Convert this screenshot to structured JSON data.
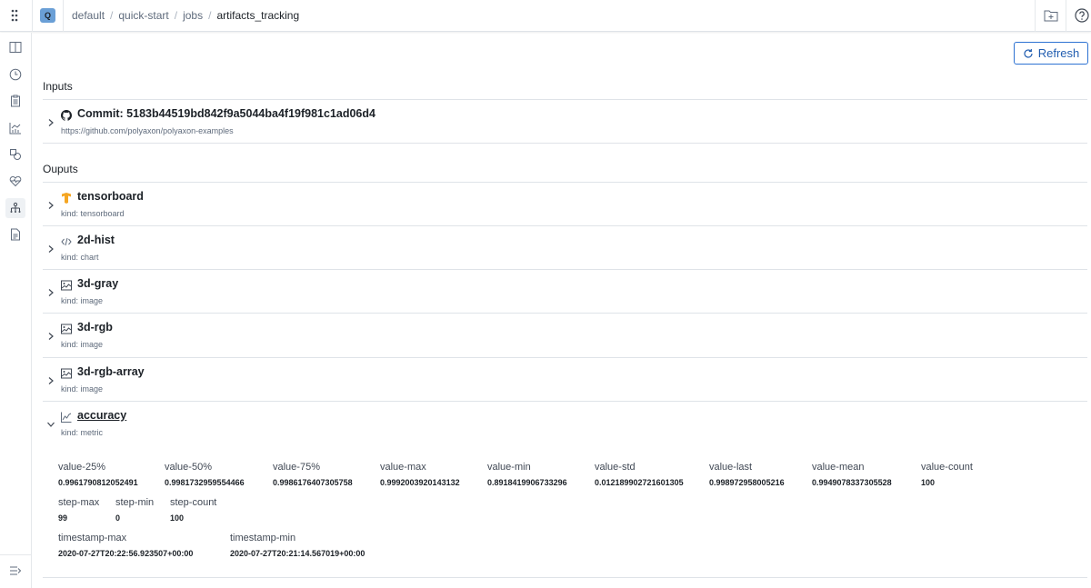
{
  "topbar": {
    "org_initial": "Q",
    "breadcrumbs": [
      "default",
      "quick-start",
      "jobs",
      "artifacts_tracking"
    ],
    "separator": "/"
  },
  "sidebar": {
    "items": [
      {
        "name": "sidebar-item-overview",
        "icon": "columns-icon"
      },
      {
        "name": "sidebar-item-history",
        "icon": "clock-icon"
      },
      {
        "name": "sidebar-item-logs",
        "icon": "clipboard-icon"
      },
      {
        "name": "sidebar-item-dashboards",
        "icon": "timeline-chart-icon"
      },
      {
        "name": "sidebar-item-events",
        "icon": "shapes-icon"
      },
      {
        "name": "sidebar-item-resources",
        "icon": "heart-pulse-icon"
      },
      {
        "name": "sidebar-item-lineage",
        "icon": "hierarchy-icon",
        "active": true
      },
      {
        "name": "sidebar-item-specification",
        "icon": "document-icon"
      }
    ]
  },
  "actions": {
    "refresh_label": "Refresh"
  },
  "inputs": {
    "title": "Inputs",
    "items": [
      {
        "title": "Commit: 5183b44519bd842f9a5044ba4f19f981c1ad06d4",
        "subtitle": "https://github.com/polyaxon/polyaxon-examples",
        "icon": "github-icon"
      }
    ]
  },
  "outputs": {
    "title": "Ouputs",
    "items": [
      {
        "title": "tensorboard",
        "subtitle": "kind: tensorboard",
        "icon": "tensorboard-icon",
        "expanded": false
      },
      {
        "title": "2d-hist",
        "subtitle": "kind: chart",
        "icon": "code-icon",
        "expanded": false
      },
      {
        "title": "3d-gray",
        "subtitle": "kind: image",
        "icon": "image-icon",
        "expanded": false
      },
      {
        "title": "3d-rgb",
        "subtitle": "kind: image",
        "icon": "image-icon",
        "expanded": false
      },
      {
        "title": "3d-rgb-array",
        "subtitle": "kind: image",
        "icon": "image-icon",
        "expanded": false
      },
      {
        "title": "accuracy",
        "subtitle": "kind: metric",
        "icon": "line-chart-icon",
        "expanded": true
      }
    ],
    "accuracy_stats": {
      "row1": [
        {
          "key": "value-25%",
          "value": "0.9961790812052491"
        },
        {
          "key": "value-50%",
          "value": "0.9981732959554466"
        },
        {
          "key": "value-75%",
          "value": "0.9986176407305758"
        },
        {
          "key": "value-max",
          "value": "0.9992003920143132"
        },
        {
          "key": "value-min",
          "value": "0.8918419906733296"
        },
        {
          "key": "value-std",
          "value": "0.012189902721601305"
        },
        {
          "key": "value-last",
          "value": "0.998972958005216"
        },
        {
          "key": "value-mean",
          "value": "0.9949078337305528"
        },
        {
          "key": "value-count",
          "value": "100"
        }
      ],
      "row2": [
        {
          "key": "step-max",
          "value": "99"
        },
        {
          "key": "step-min",
          "value": "0"
        },
        {
          "key": "step-count",
          "value": "100"
        }
      ],
      "row3": [
        {
          "key": "timestamp-max",
          "value": "2020-07-27T20:22:56.923507+00:00"
        },
        {
          "key": "timestamp-min",
          "value": "2020-07-27T20:21:14.567019+00:00"
        }
      ]
    }
  }
}
